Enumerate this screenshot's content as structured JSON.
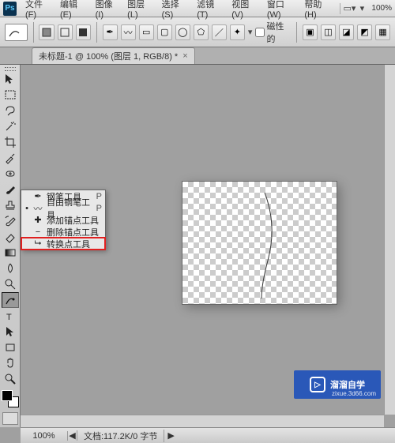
{
  "menubar": {
    "items": [
      {
        "label": "文件(F)"
      },
      {
        "label": "编辑(E)"
      },
      {
        "label": "图像(I)"
      },
      {
        "label": "图层(L)"
      },
      {
        "label": "选择(S)"
      },
      {
        "label": "滤镜(T)"
      },
      {
        "label": "视图(V)"
      },
      {
        "label": "窗口(W)"
      },
      {
        "label": "帮助(H)"
      }
    ],
    "zoom_display": "100%"
  },
  "options_bar": {
    "magnetic_label": "磁性的"
  },
  "document_tab": {
    "title": "未标题-1 @ 100% (图层 1, RGB/8) *",
    "close_glyph": "×"
  },
  "toolbar": {
    "tools": [
      {
        "name": "move-tool"
      },
      {
        "name": "rect-marquee-tool"
      },
      {
        "name": "lasso-tool"
      },
      {
        "name": "magic-wand-tool"
      },
      {
        "name": "crop-tool"
      },
      {
        "name": "eyedropper-tool"
      },
      {
        "name": "healing-brush-tool"
      },
      {
        "name": "brush-tool"
      },
      {
        "name": "stamp-tool"
      },
      {
        "name": "history-brush-tool"
      },
      {
        "name": "eraser-tool"
      },
      {
        "name": "gradient-tool"
      },
      {
        "name": "blur-tool"
      },
      {
        "name": "dodge-tool"
      },
      {
        "name": "pen-tool",
        "active": true
      },
      {
        "name": "type-tool"
      },
      {
        "name": "path-select-tool"
      },
      {
        "name": "shape-tool"
      },
      {
        "name": "hand-tool"
      },
      {
        "name": "zoom-tool"
      }
    ]
  },
  "pen_flyout": {
    "items": [
      {
        "bullet": "",
        "label": "钢笔工具",
        "key": "P",
        "name": "pen-tool-item"
      },
      {
        "bullet": "•",
        "label": "自由钢笔工具",
        "key": "P",
        "name": "freeform-pen-tool-item"
      },
      {
        "bullet": "",
        "label": "添加锚点工具",
        "key": "",
        "name": "add-anchor-tool-item"
      },
      {
        "bullet": "",
        "label": "删除锚点工具",
        "key": "",
        "name": "delete-anchor-tool-item"
      },
      {
        "bullet": "",
        "label": "转换点工具",
        "key": "",
        "name": "convert-point-tool-item",
        "highlight": true
      }
    ]
  },
  "status": {
    "zoom": "100%",
    "nav": "◀",
    "doc_info": "文档:117.2K/0 字节",
    "triangle": "▶"
  },
  "watermark": {
    "text": "溜溜自学",
    "sub": "zixue.3d66.com",
    "play": "▷"
  }
}
